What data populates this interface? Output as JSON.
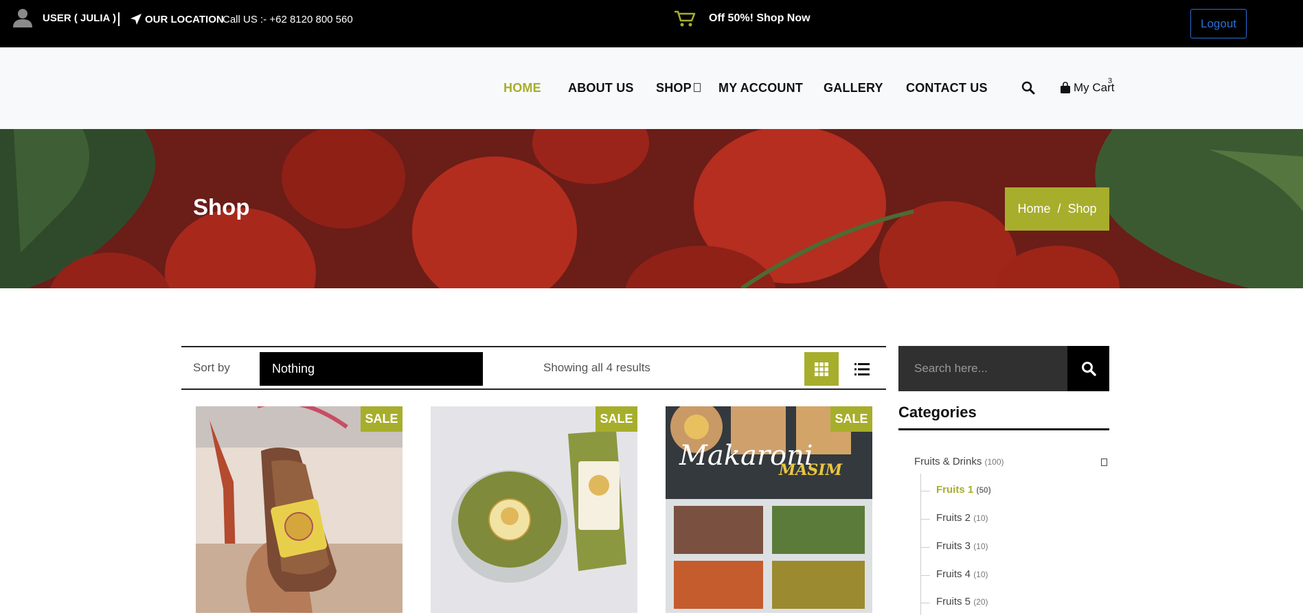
{
  "topbar": {
    "user_label": "USER ( JULIA )",
    "location_label": "OUR LOCATION",
    "call_label": "Call US :- +62 8120 800 560",
    "offer_label": "Off 50%! Shop Now",
    "logout_label": "Logout"
  },
  "nav": {
    "items": [
      "HOME",
      "ABOUT US",
      "SHOP",
      "MY ACCOUNT",
      "GALLERY",
      "CONTACT US"
    ],
    "active": "HOME",
    "cart_label": "My Cart",
    "cart_count": "3"
  },
  "hero": {
    "title": "Shop",
    "breadcrumb_home": "Home",
    "breadcrumb_sep": "/",
    "breadcrumb_current": "Shop"
  },
  "toolbar": {
    "sort_label": "Sort by",
    "sort_value": "Nothing",
    "results_text": "Showing all 4 results"
  },
  "products": [
    {
      "badge": "SALE"
    },
    {
      "badge": "SALE"
    },
    {
      "badge": "SALE"
    }
  ],
  "sidebar": {
    "search_placeholder": "Search here...",
    "categories_title": "Categories",
    "parent": {
      "name": "Fruits & Drinks",
      "count": "(100)"
    },
    "children": [
      {
        "name": "Fruits 1",
        "count": "(50)"
      },
      {
        "name": "Fruits 2",
        "count": "(10)"
      },
      {
        "name": "Fruits 3",
        "count": "(10)"
      },
      {
        "name": "Fruits 4",
        "count": "(10)"
      },
      {
        "name": "Fruits 5",
        "count": "(20)"
      }
    ]
  },
  "colors": {
    "accent": "#a7ae2c",
    "topbar_bg": "#000000",
    "logout_border": "#2c6fd6"
  }
}
